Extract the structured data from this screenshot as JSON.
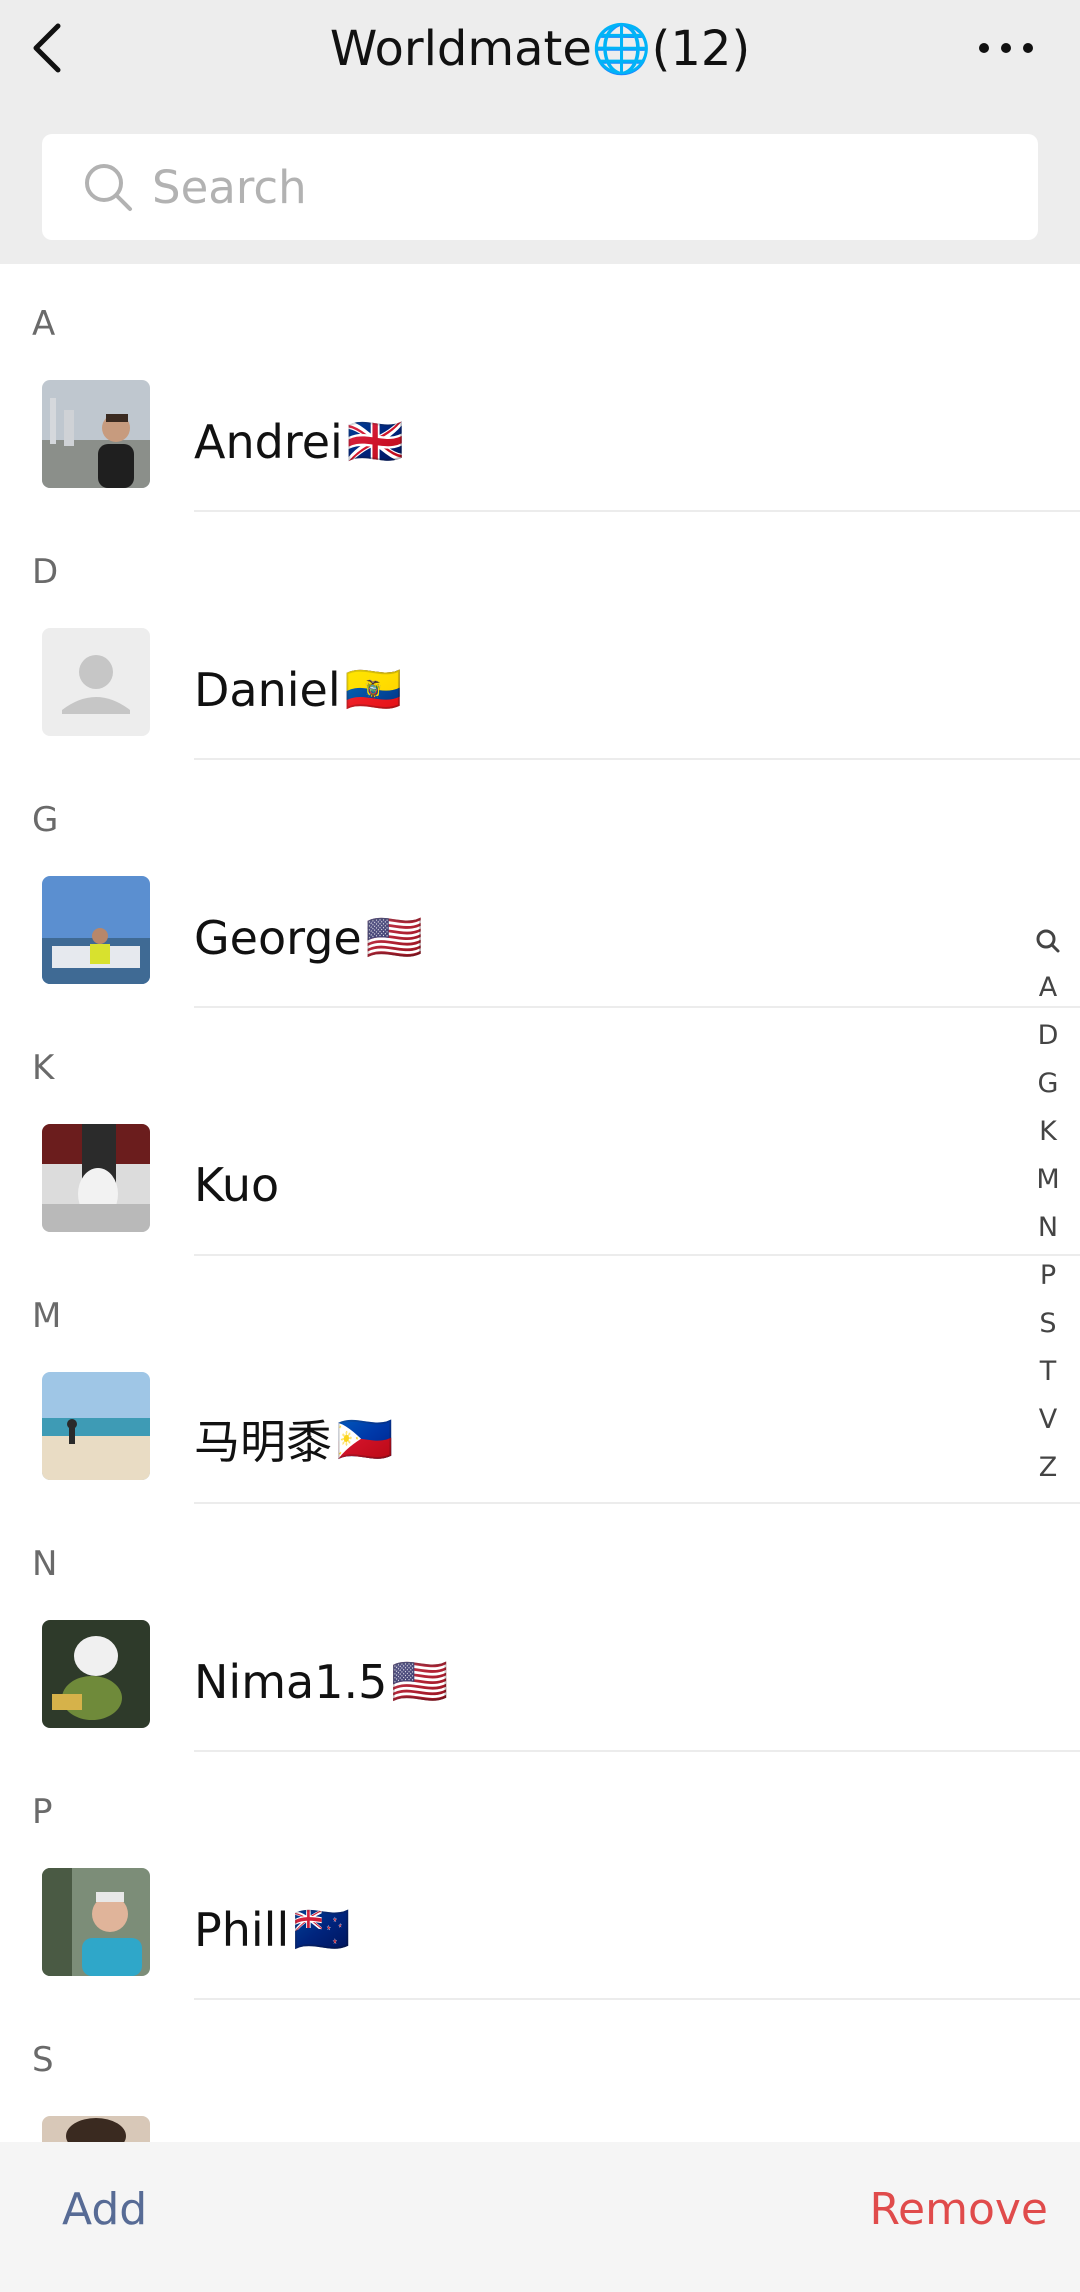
{
  "header": {
    "title": "Worldmate🌐(12)",
    "back_icon": "chevron-left-icon",
    "more_icon": "more-dots-icon"
  },
  "search": {
    "placeholder": "Search",
    "icon": "search-icon"
  },
  "sections": [
    {
      "letter": "A",
      "contacts": [
        {
          "name": "Andrei",
          "flag": "🇬🇧",
          "avatar": "photo"
        }
      ]
    },
    {
      "letter": "D",
      "contacts": [
        {
          "name": "Daniel",
          "flag": "🇪🇨",
          "avatar": "default"
        }
      ]
    },
    {
      "letter": "G",
      "contacts": [
        {
          "name": "George",
          "flag": "🇺🇸",
          "avatar": "photo"
        }
      ]
    },
    {
      "letter": "K",
      "contacts": [
        {
          "name": "Kuo",
          "flag": "",
          "avatar": "photo"
        }
      ]
    },
    {
      "letter": "M",
      "contacts": [
        {
          "name": "马明黍",
          "flag": "🇵🇭",
          "avatar": "photo"
        }
      ]
    },
    {
      "letter": "N",
      "contacts": [
        {
          "name": "Nima1.5",
          "flag": "🇺🇸",
          "avatar": "photo"
        }
      ]
    },
    {
      "letter": "P",
      "contacts": [
        {
          "name": "Phill",
          "flag": "🇳🇿",
          "avatar": "photo"
        }
      ]
    },
    {
      "letter": "S",
      "contacts": [
        {
          "name": "",
          "flag": "",
          "avatar": "photo"
        }
      ]
    }
  ],
  "index_bar": [
    "A",
    "D",
    "G",
    "K",
    "M",
    "N",
    "P",
    "S",
    "T",
    "V",
    "Z"
  ],
  "footer": {
    "add_label": "Add",
    "remove_label": "Remove"
  },
  "colors": {
    "header_bg": "#ededed",
    "link_blue": "#576b95",
    "remove_red": "#e04b4b"
  }
}
